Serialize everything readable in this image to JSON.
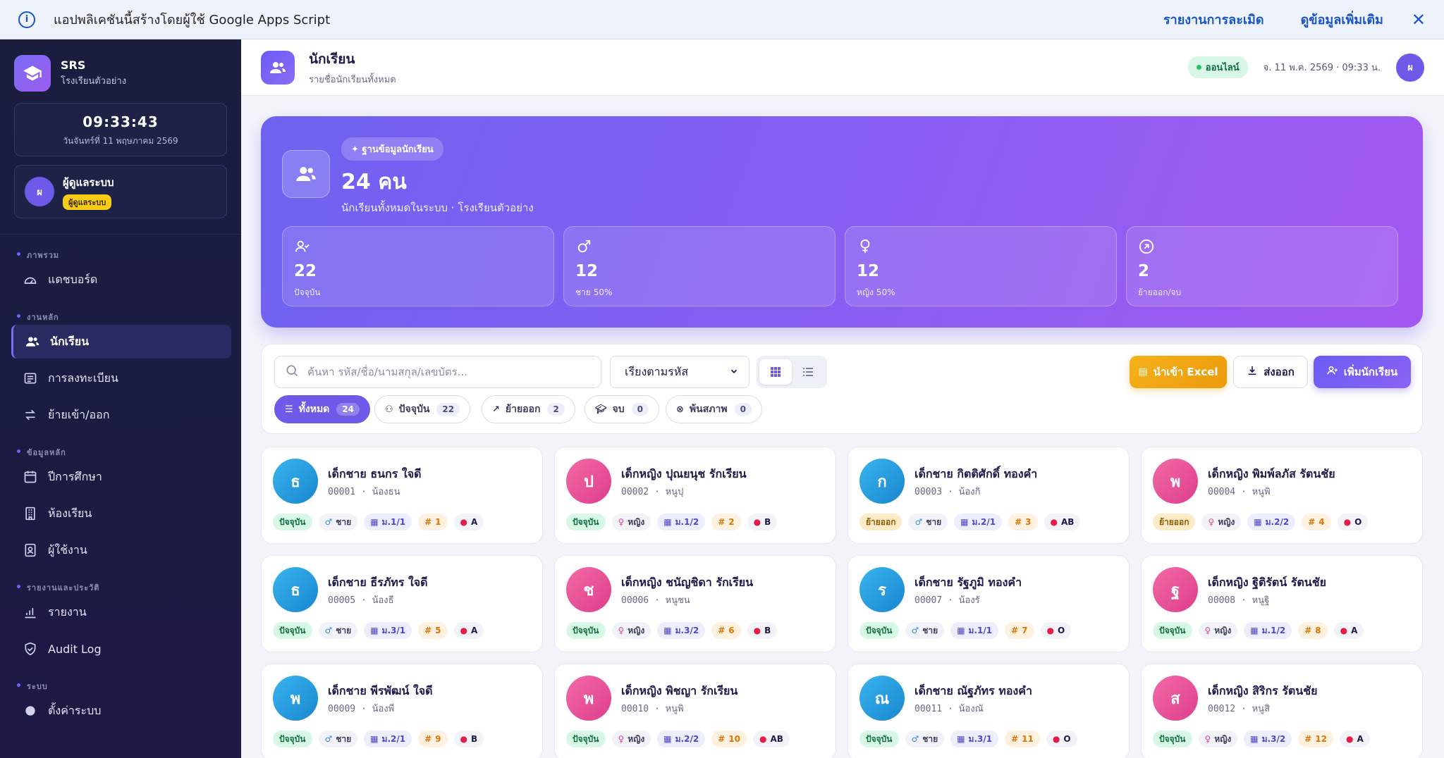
{
  "banner": {
    "text": "แอปพลิเคชันนี้สร้างโดยผู้ใช้ Google Apps Script",
    "report": "รายงานการละเมิด",
    "more": "ดูข้อมูลเพิ่มเติม",
    "close": "✕",
    "info": "i"
  },
  "sidebar": {
    "brand": {
      "title": "SRS",
      "subtitle": "โรงเรียนตัวอย่าง"
    },
    "clock": {
      "time": "09:33:43",
      "date": "วันจันทร์ที่ 11 พฤษภาคม 2569"
    },
    "user": {
      "initial": "ผ",
      "name": "ผู้ดูแลระบบ",
      "role": "ผู้ดูแลระบบ"
    },
    "sections": [
      {
        "label": "ภาพรวม",
        "items": [
          {
            "label": "แดชบอร์ด",
            "icon": "dashboard-icon"
          }
        ]
      },
      {
        "label": "งานหลัก",
        "items": [
          {
            "label": "นักเรียน",
            "icon": "users-icon",
            "active": true
          },
          {
            "label": "การลงทะเบียน",
            "icon": "register-icon"
          },
          {
            "label": "ย้ายเข้า/ออก",
            "icon": "transfer-icon"
          }
        ]
      },
      {
        "label": "ข้อมูลหลัก",
        "items": [
          {
            "label": "ปีการศึกษา",
            "icon": "calendar-icon"
          },
          {
            "label": "ห้องเรียน",
            "icon": "building-icon"
          },
          {
            "label": "ผู้ใช้งาน",
            "icon": "user-badge-icon"
          }
        ]
      },
      {
        "label": "รายงานและประวัติ",
        "items": [
          {
            "label": "รายงาน",
            "icon": "chart-icon"
          },
          {
            "label": "Audit Log",
            "icon": "shield-icon"
          }
        ]
      },
      {
        "label": "ระบบ",
        "items": [
          {
            "label": "ตั้งค่าระบบ",
            "icon": "gear-icon"
          }
        ]
      }
    ]
  },
  "header": {
    "title": "นักเรียน",
    "subtitle": "รายชื่อนักเรียนทั้งหมด",
    "status": "ออนไลน์",
    "datetime": "จ. 11 พ.ค. 2569 · 09:33 น.",
    "avatar": "ผ"
  },
  "hero": {
    "tag": "✦ ฐานข้อมูลนักเรียน",
    "total": "24 คน",
    "subtitle": "นักเรียนทั้งหมดในระบบ · โรงเรียนตัวอย่าง",
    "stats": [
      {
        "value": "22",
        "label": "ปัจจุบัน",
        "icon": "user-check-icon"
      },
      {
        "value": "12",
        "label": "ชาย 50%",
        "icon": "male-icon"
      },
      {
        "value": "12",
        "label": "หญิง 50%",
        "icon": "female-icon"
      },
      {
        "value": "2",
        "label": "ย้ายออก/จบ",
        "icon": "arrow-out-icon"
      }
    ]
  },
  "toolbar": {
    "search_placeholder": "ค้นหา รหัส/ชื่อ/นามสกุล/เลขบัตร...",
    "sort": "เรียงตามรหัส",
    "import": "นำเข้า Excel",
    "export": "ส่งออก",
    "add": "เพิ่มนักเรียน",
    "filters": [
      {
        "label": "ทั้งหมด",
        "count": "24"
      },
      {
        "label": "ปัจจุบัน",
        "count": "22"
      },
      {
        "label": "ย้ายออก",
        "count": "2"
      },
      {
        "label": "จบ",
        "count": "0"
      },
      {
        "label": "พ้นสภาพ",
        "count": "0"
      }
    ]
  },
  "students": [
    {
      "initial": "ธ",
      "name": "เด็กชาย ธนกร ใจดี",
      "code": "00001 · น้องธน",
      "status": "ปัจจุบัน",
      "gender": "ชาย",
      "class": "ม.1/1",
      "no": "1",
      "blood": "A"
    },
    {
      "initial": "ป",
      "name": "เด็กหญิง ปุณยนุช รักเรียน",
      "code": "00002 · หนูปุ",
      "status": "ปัจจุบัน",
      "gender": "หญิง",
      "class": "ม.1/2",
      "no": "2",
      "blood": "B"
    },
    {
      "initial": "ก",
      "name": "เด็กชาย กิตติศักดิ์ ทองคำ",
      "code": "00003 · น้องกิ",
      "status": "ย้ายออก",
      "gender": "ชาย",
      "class": "ม.2/1",
      "no": "3",
      "blood": "AB"
    },
    {
      "initial": "พ",
      "name": "เด็กหญิง พิมพ์ลภัส รัตนชัย",
      "code": "00004 · หนูพิ",
      "status": "ย้ายออก",
      "gender": "หญิง",
      "class": "ม.2/2",
      "no": "4",
      "blood": "O"
    },
    {
      "initial": "ธ",
      "name": "เด็กชาย ธีรภัทร ใจดี",
      "code": "00005 · น้องธี",
      "status": "ปัจจุบัน",
      "gender": "ชาย",
      "class": "ม.3/1",
      "no": "5",
      "blood": "A"
    },
    {
      "initial": "ช",
      "name": "เด็กหญิง ชนัญชิดา รักเรียน",
      "code": "00006 · หนูชน",
      "status": "ปัจจุบัน",
      "gender": "หญิง",
      "class": "ม.3/2",
      "no": "6",
      "blood": "B"
    },
    {
      "initial": "ร",
      "name": "เด็กชาย รัฐภูมิ ทองคำ",
      "code": "00007 · น้องรั",
      "status": "ปัจจุบัน",
      "gender": "ชาย",
      "class": "ม.1/1",
      "no": "7",
      "blood": "O"
    },
    {
      "initial": "ฐ",
      "name": "เด็กหญิง ฐิติรัตน์ รัตนชัย",
      "code": "00008 · หนูฐิ",
      "status": "ปัจจุบัน",
      "gender": "หญิง",
      "class": "ม.1/2",
      "no": "8",
      "blood": "A"
    },
    {
      "initial": "พ",
      "name": "เด็กชาย พีรพัฒน์ ใจดี",
      "code": "00009 · น้องพี",
      "status": "ปัจจุบัน",
      "gender": "ชาย",
      "class": "ม.2/1",
      "no": "9",
      "blood": "B"
    },
    {
      "initial": "พ",
      "name": "เด็กหญิง พิชญา รักเรียน",
      "code": "00010 · หนูพิ",
      "status": "ปัจจุบัน",
      "gender": "หญิง",
      "class": "ม.2/2",
      "no": "10",
      "blood": "AB"
    },
    {
      "initial": "ณ",
      "name": "เด็กชาย ณัฐภัทร ทองคำ",
      "code": "00011 · น้องณั",
      "status": "ปัจจุบัน",
      "gender": "ชาย",
      "class": "ม.3/1",
      "no": "11",
      "blood": "O"
    },
    {
      "initial": "ส",
      "name": "เด็กหญิง สิริกร รัตนชัย",
      "code": "00012 · หนูสิ",
      "status": "ปัจจุบัน",
      "gender": "หญิง",
      "class": "ม.3/2",
      "no": "12",
      "blood": "A"
    }
  ]
}
